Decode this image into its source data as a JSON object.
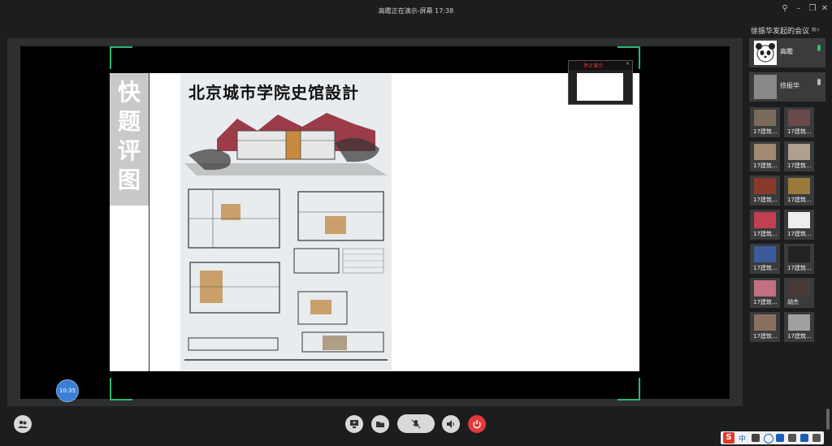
{
  "window": {
    "title": "高瞻正在演示-屏幕 17:38"
  },
  "slide": {
    "side_label": "快题评图",
    "poster_title": "北京城市学院史馆設計"
  },
  "mini_preview": {
    "label": "停止演示",
    "close": "×"
  },
  "timer": {
    "text": "10:35"
  },
  "sidebar": {
    "title": "徐振华发起的会议",
    "main_participants": [
      {
        "name": "高瞻"
      },
      {
        "name": "徐振华"
      }
    ],
    "participants": [
      {
        "name": "17建筑..."
      },
      {
        "name": "17建筑..."
      },
      {
        "name": "17建筑..."
      },
      {
        "name": "17建筑..."
      },
      {
        "name": "17建筑..."
      },
      {
        "name": "17建筑..."
      },
      {
        "name": "17建筑..."
      },
      {
        "name": "17建筑..."
      },
      {
        "name": "17建筑..."
      },
      {
        "name": "17建筑..."
      },
      {
        "name": "17建筑..."
      },
      {
        "name": "胡杰"
      },
      {
        "name": "17建筑..."
      },
      {
        "name": "17建筑..."
      }
    ]
  },
  "ime": {
    "logo": "S",
    "mode": "中"
  },
  "colors": {
    "accent_green": "#2bb673",
    "end_red": "#e23b3b",
    "mic_green": "#30c060"
  }
}
